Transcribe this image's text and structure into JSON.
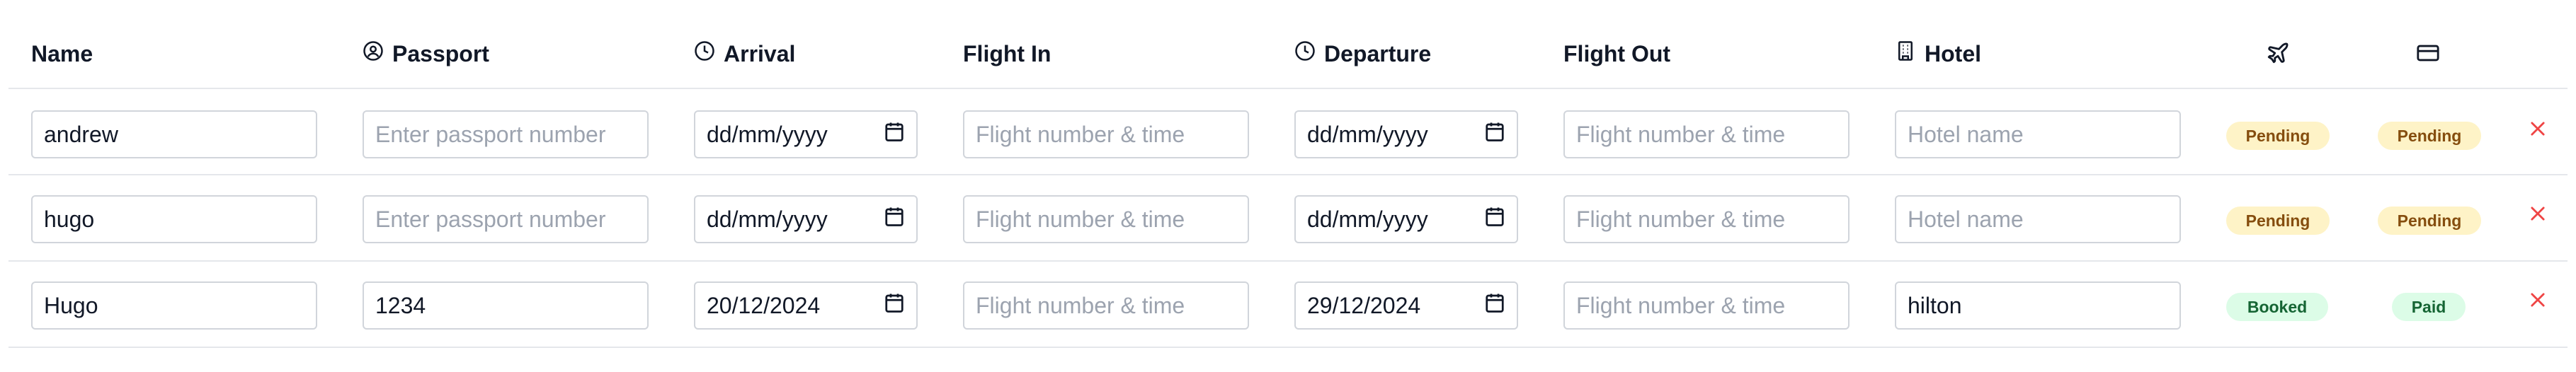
{
  "headers": {
    "name": "Name",
    "passport": "Passport",
    "arrival": "Arrival",
    "flight_in": "Flight In",
    "departure": "Departure",
    "flight_out": "Flight Out",
    "hotel": "Hotel"
  },
  "header_icons": {
    "passport": "user-circle-icon",
    "arrival": "clock-icon",
    "departure": "clock-icon",
    "hotel": "building-icon",
    "flight_status": "plane-icon",
    "payment_status": "credit-card-icon"
  },
  "placeholders": {
    "passport": "Enter passport number",
    "flight": "Flight number & time",
    "hotel": "Hotel name"
  },
  "rows": [
    {
      "name": "andrew",
      "passport": "",
      "arrival": "dd/mm/yyyy",
      "flight_in": "",
      "departure": "dd/mm/yyyy",
      "flight_out": "",
      "hotel": "",
      "flight_status": "Pending",
      "payment_status": "Pending"
    },
    {
      "name": "hugo",
      "passport": "",
      "arrival": "dd/mm/yyyy",
      "flight_in": "",
      "departure": "dd/mm/yyyy",
      "flight_out": "",
      "hotel": "",
      "flight_status": "Pending",
      "payment_status": "Pending"
    },
    {
      "name": "Hugo",
      "passport": "1234",
      "arrival": "20/12/2024",
      "flight_in": "",
      "departure": "29/12/2024",
      "flight_out": "",
      "hotel": "hilton",
      "flight_status": "Booked",
      "payment_status": "Paid"
    }
  ],
  "colors": {
    "pending_bg": "#fef3c7",
    "pending_text": "#854d0e",
    "ok_bg": "#dcfce7",
    "ok_text": "#166534",
    "delete": "#ef4444",
    "border": "#d1d5db",
    "rule": "#e5e7eb"
  },
  "delete_icon": "x-icon",
  "calendar_icon": "calendar-icon"
}
